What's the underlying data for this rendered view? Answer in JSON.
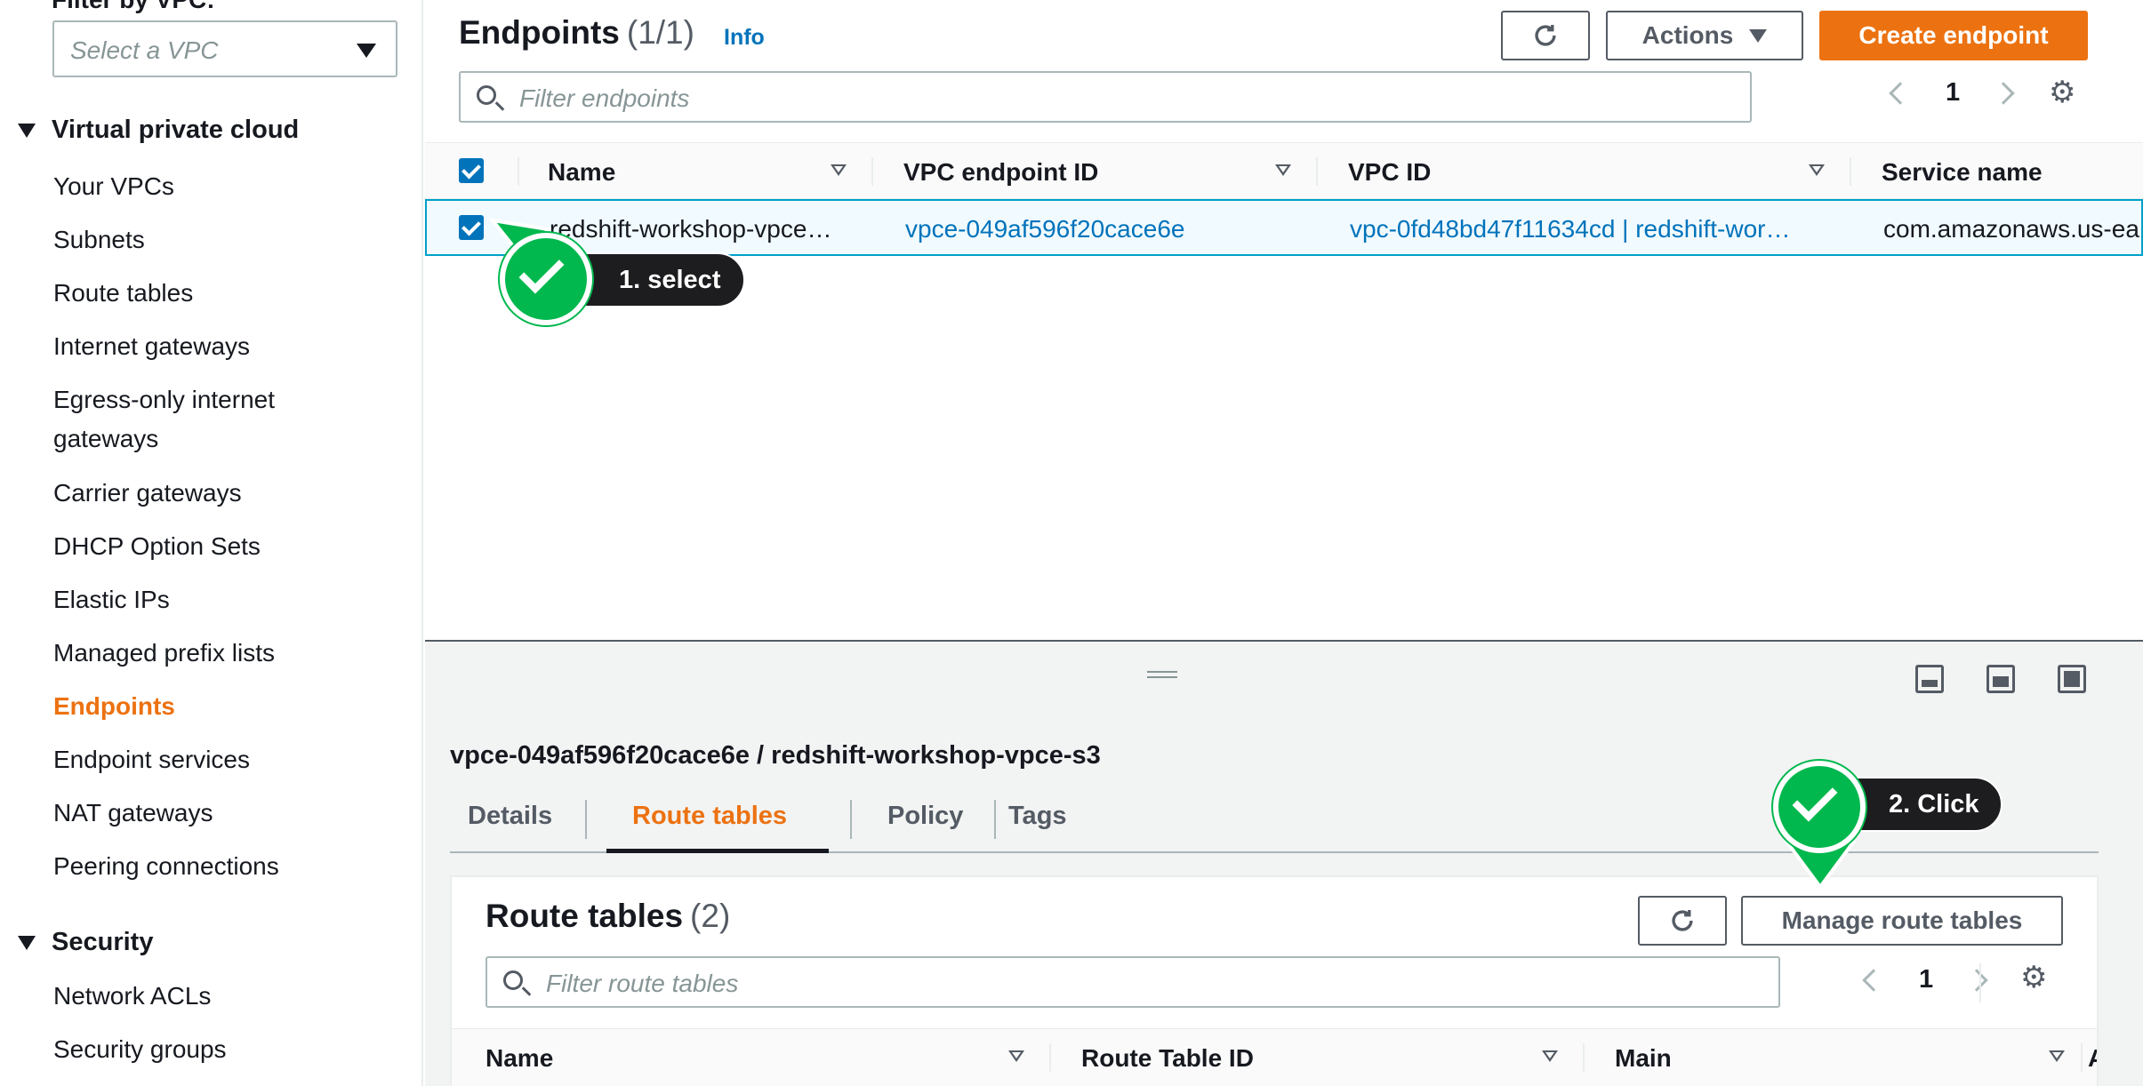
{
  "sidebar": {
    "filter_label": "Filter by VPC:",
    "vpc_select_placeholder": "Select a VPC",
    "sections": [
      {
        "title": "Virtual private cloud"
      },
      {
        "title": "Security"
      }
    ],
    "items": {
      "your_vpcs": "Your VPCs",
      "subnets": "Subnets",
      "route_tables": "Route tables",
      "internet_gateways": "Internet gateways",
      "egress_1": "Egress-only internet",
      "egress_2": "gateways",
      "carrier_gateways": "Carrier gateways",
      "dhcp": "DHCP Option Sets",
      "elastic_ips": "Elastic IPs",
      "prefix_lists": "Managed prefix lists",
      "endpoints": "Endpoints",
      "endpoint_services": "Endpoint services",
      "nat_gateways": "NAT gateways",
      "peering": "Peering connections",
      "network_acls": "Network ACLs",
      "security_groups": "Security groups"
    }
  },
  "endpoints": {
    "title": "Endpoints",
    "count": "(1/1)",
    "info": "Info",
    "actions_label": "Actions",
    "create_label": "Create endpoint",
    "filter_placeholder": "Filter endpoints",
    "page": "1",
    "columns": {
      "name": "Name",
      "endpoint_id": "VPC endpoint ID",
      "vpc_id": "VPC ID",
      "service_name": "Service name"
    },
    "rows": [
      {
        "name": "redshift-workshop-vpce…",
        "endpoint_id": "vpce-049af596f20cace6e",
        "vpc_id": "vpc-0fd48bd47f11634cd | redshift-wor…",
        "service_name": "com.amazonaws.us-ea"
      }
    ]
  },
  "detail": {
    "title": "vpce-049af596f20cace6e / redshift-workshop-vpce-s3",
    "tabs": [
      "Details",
      "Route tables",
      "Policy",
      "Tags"
    ],
    "active_tab": "Route tables",
    "route_tables": {
      "title": "Route tables",
      "count": "(2)",
      "manage_label": "Manage route tables",
      "filter_placeholder": "Filter route tables",
      "page": "1",
      "columns": {
        "name": "Name",
        "route_table_id": "Route Table ID",
        "main": "Main",
        "extra": "A"
      }
    }
  },
  "annotations": {
    "step1": "1. select",
    "step2": "2. Click"
  },
  "colors": {
    "accent": "#ec7211",
    "link": "#0073bb",
    "annotation_green": "#00b84e"
  }
}
